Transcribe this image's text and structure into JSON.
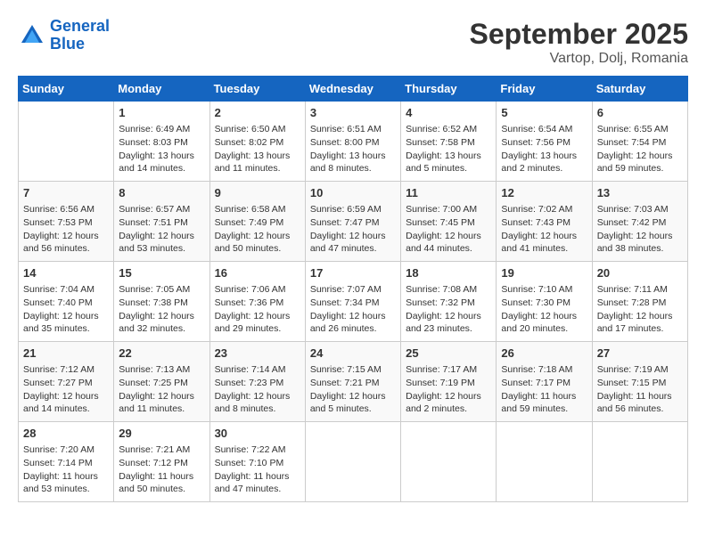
{
  "header": {
    "logo_line1": "General",
    "logo_line2": "Blue",
    "month": "September 2025",
    "location": "Vartop, Dolj, Romania"
  },
  "weekdays": [
    "Sunday",
    "Monday",
    "Tuesday",
    "Wednesday",
    "Thursday",
    "Friday",
    "Saturday"
  ],
  "weeks": [
    [
      {
        "day": "",
        "info": ""
      },
      {
        "day": "1",
        "info": "Sunrise: 6:49 AM\nSunset: 8:03 PM\nDaylight: 13 hours\nand 14 minutes."
      },
      {
        "day": "2",
        "info": "Sunrise: 6:50 AM\nSunset: 8:02 PM\nDaylight: 13 hours\nand 11 minutes."
      },
      {
        "day": "3",
        "info": "Sunrise: 6:51 AM\nSunset: 8:00 PM\nDaylight: 13 hours\nand 8 minutes."
      },
      {
        "day": "4",
        "info": "Sunrise: 6:52 AM\nSunset: 7:58 PM\nDaylight: 13 hours\nand 5 minutes."
      },
      {
        "day": "5",
        "info": "Sunrise: 6:54 AM\nSunset: 7:56 PM\nDaylight: 13 hours\nand 2 minutes."
      },
      {
        "day": "6",
        "info": "Sunrise: 6:55 AM\nSunset: 7:54 PM\nDaylight: 12 hours\nand 59 minutes."
      }
    ],
    [
      {
        "day": "7",
        "info": "Sunrise: 6:56 AM\nSunset: 7:53 PM\nDaylight: 12 hours\nand 56 minutes."
      },
      {
        "day": "8",
        "info": "Sunrise: 6:57 AM\nSunset: 7:51 PM\nDaylight: 12 hours\nand 53 minutes."
      },
      {
        "day": "9",
        "info": "Sunrise: 6:58 AM\nSunset: 7:49 PM\nDaylight: 12 hours\nand 50 minutes."
      },
      {
        "day": "10",
        "info": "Sunrise: 6:59 AM\nSunset: 7:47 PM\nDaylight: 12 hours\nand 47 minutes."
      },
      {
        "day": "11",
        "info": "Sunrise: 7:00 AM\nSunset: 7:45 PM\nDaylight: 12 hours\nand 44 minutes."
      },
      {
        "day": "12",
        "info": "Sunrise: 7:02 AM\nSunset: 7:43 PM\nDaylight: 12 hours\nand 41 minutes."
      },
      {
        "day": "13",
        "info": "Sunrise: 7:03 AM\nSunset: 7:42 PM\nDaylight: 12 hours\nand 38 minutes."
      }
    ],
    [
      {
        "day": "14",
        "info": "Sunrise: 7:04 AM\nSunset: 7:40 PM\nDaylight: 12 hours\nand 35 minutes."
      },
      {
        "day": "15",
        "info": "Sunrise: 7:05 AM\nSunset: 7:38 PM\nDaylight: 12 hours\nand 32 minutes."
      },
      {
        "day": "16",
        "info": "Sunrise: 7:06 AM\nSunset: 7:36 PM\nDaylight: 12 hours\nand 29 minutes."
      },
      {
        "day": "17",
        "info": "Sunrise: 7:07 AM\nSunset: 7:34 PM\nDaylight: 12 hours\nand 26 minutes."
      },
      {
        "day": "18",
        "info": "Sunrise: 7:08 AM\nSunset: 7:32 PM\nDaylight: 12 hours\nand 23 minutes."
      },
      {
        "day": "19",
        "info": "Sunrise: 7:10 AM\nSunset: 7:30 PM\nDaylight: 12 hours\nand 20 minutes."
      },
      {
        "day": "20",
        "info": "Sunrise: 7:11 AM\nSunset: 7:28 PM\nDaylight: 12 hours\nand 17 minutes."
      }
    ],
    [
      {
        "day": "21",
        "info": "Sunrise: 7:12 AM\nSunset: 7:27 PM\nDaylight: 12 hours\nand 14 minutes."
      },
      {
        "day": "22",
        "info": "Sunrise: 7:13 AM\nSunset: 7:25 PM\nDaylight: 12 hours\nand 11 minutes."
      },
      {
        "day": "23",
        "info": "Sunrise: 7:14 AM\nSunset: 7:23 PM\nDaylight: 12 hours\nand 8 minutes."
      },
      {
        "day": "24",
        "info": "Sunrise: 7:15 AM\nSunset: 7:21 PM\nDaylight: 12 hours\nand 5 minutes."
      },
      {
        "day": "25",
        "info": "Sunrise: 7:17 AM\nSunset: 7:19 PM\nDaylight: 12 hours\nand 2 minutes."
      },
      {
        "day": "26",
        "info": "Sunrise: 7:18 AM\nSunset: 7:17 PM\nDaylight: 11 hours\nand 59 minutes."
      },
      {
        "day": "27",
        "info": "Sunrise: 7:19 AM\nSunset: 7:15 PM\nDaylight: 11 hours\nand 56 minutes."
      }
    ],
    [
      {
        "day": "28",
        "info": "Sunrise: 7:20 AM\nSunset: 7:14 PM\nDaylight: 11 hours\nand 53 minutes."
      },
      {
        "day": "29",
        "info": "Sunrise: 7:21 AM\nSunset: 7:12 PM\nDaylight: 11 hours\nand 50 minutes."
      },
      {
        "day": "30",
        "info": "Sunrise: 7:22 AM\nSunset: 7:10 PM\nDaylight: 11 hours\nand 47 minutes."
      },
      {
        "day": "",
        "info": ""
      },
      {
        "day": "",
        "info": ""
      },
      {
        "day": "",
        "info": ""
      },
      {
        "day": "",
        "info": ""
      }
    ]
  ]
}
